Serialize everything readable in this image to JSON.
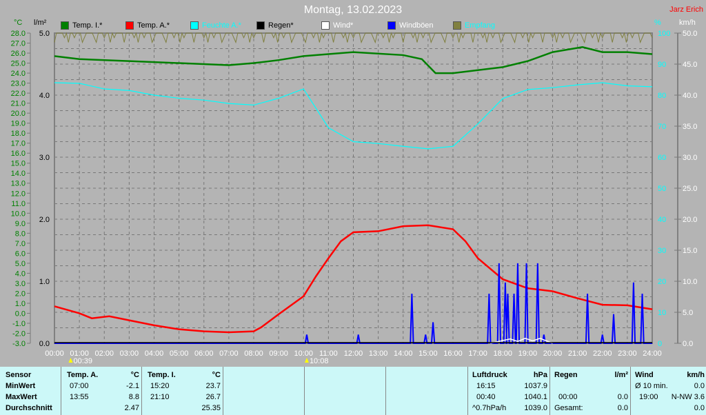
{
  "header": {
    "title": "Montag, 13.02.2023",
    "author": "Jarz Erich"
  },
  "axes": {
    "left1_unit": "°C",
    "left2_unit": "l/m²",
    "right1_unit": "%",
    "right2_unit": "km/h"
  },
  "legend": [
    {
      "label": "Temp. I.*",
      "color": "#008000",
      "text": "#000"
    },
    {
      "label": "Temp. A.*",
      "color": "#ff0000",
      "text": "#000"
    },
    {
      "label": "Feuchte A.*",
      "color": "#00ffff",
      "text": "#00ffff"
    },
    {
      "label": "Regen*",
      "color": "#000000",
      "text": "#000"
    },
    {
      "label": "Wind*",
      "color": "#ffffff",
      "text": "#fff"
    },
    {
      "label": "Windböen",
      "color": "#0000ff",
      "text": "#fff"
    },
    {
      "label": "Empfang",
      "color": "#808040",
      "text": "#00ffff"
    }
  ],
  "markers": [
    {
      "time": "00:39",
      "hour": 0.65
    },
    {
      "time": "10:08",
      "hour": 10.13
    }
  ],
  "chart_data": {
    "type": "line",
    "title": "Montag, 13.02.2023",
    "x_ticks": [
      "00:00",
      "01:00",
      "02:00",
      "03:00",
      "04:00",
      "05:00",
      "06:00",
      "07:00",
      "08:00",
      "09:00",
      "10:00",
      "11:00",
      "12:00",
      "13:00",
      "14:00",
      "15:00",
      "16:00",
      "17:00",
      "18:00",
      "19:00",
      "20:00",
      "21:00",
      "22:00",
      "23:00",
      "24:00"
    ],
    "y_temp_range": [
      -3,
      28
    ],
    "y_rain_range": [
      0,
      5
    ],
    "y_hum_range": [
      0,
      100
    ],
    "y_wind_range": [
      0,
      50
    ],
    "y_temp_ticks": [
      "28.0",
      "27.0",
      "26.0",
      "25.0",
      "24.0",
      "23.0",
      "22.0",
      "21.0",
      "20.0",
      "19.0",
      "18.0",
      "17.0",
      "16.0",
      "15.0",
      "14.0",
      "13.0",
      "12.0",
      "11.0",
      "10.0",
      "9.0",
      "8.0",
      "7.0",
      "6.0",
      "5.0",
      "4.0",
      "3.0",
      "2.0",
      "1.0",
      "0.0",
      "-1.0",
      "-2.0",
      "-3.0"
    ],
    "y_rain_ticks": [
      "5.0",
      "4.0",
      "3.0",
      "2.0",
      "1.0",
      "0.0"
    ],
    "y_hum_ticks": [
      "100",
      "90",
      "80",
      "70",
      "60",
      "50",
      "40",
      "30",
      "20",
      "10",
      "0"
    ],
    "y_wind_ticks": [
      "50.0",
      "45.0",
      "40.0",
      "35.0",
      "30.0",
      "25.0",
      "20.0",
      "15.0",
      "10.0",
      "5.0",
      "0.0"
    ],
    "series": [
      {
        "name": "Temp. I.",
        "unit": "°C",
        "color": "#008000",
        "points": [
          [
            0,
            25.7
          ],
          [
            1,
            25.4
          ],
          [
            3,
            25.2
          ],
          [
            5,
            25.0
          ],
          [
            7,
            24.8
          ],
          [
            8,
            25.0
          ],
          [
            9,
            25.3
          ],
          [
            10,
            25.7
          ],
          [
            12,
            26.1
          ],
          [
            14,
            25.8
          ],
          [
            14.75,
            25.4
          ],
          [
            15.3,
            24.0
          ],
          [
            16,
            24.0
          ],
          [
            17,
            24.3
          ],
          [
            18,
            24.6
          ],
          [
            19,
            25.2
          ],
          [
            20,
            26.1
          ],
          [
            21.2,
            26.6
          ],
          [
            22,
            26.1
          ],
          [
            23,
            26.1
          ],
          [
            24,
            25.9
          ]
        ]
      },
      {
        "name": "Temp. A.",
        "unit": "°C",
        "color": "#ff0000",
        "points": [
          [
            0,
            0.7
          ],
          [
            1,
            0.0
          ],
          [
            1.5,
            -0.5
          ],
          [
            2.2,
            -0.3
          ],
          [
            3,
            -0.7
          ],
          [
            4,
            -1.2
          ],
          [
            5,
            -1.6
          ],
          [
            6,
            -1.8
          ],
          [
            7,
            -1.9
          ],
          [
            8,
            -1.8
          ],
          [
            8.3,
            -1.4
          ],
          [
            9,
            -0.1
          ],
          [
            10,
            1.7
          ],
          [
            10.5,
            3.7
          ],
          [
            11,
            5.5
          ],
          [
            11.5,
            7.2
          ],
          [
            12,
            8.1
          ],
          [
            13,
            8.2
          ],
          [
            14,
            8.7
          ],
          [
            15,
            8.8
          ],
          [
            16,
            8.4
          ],
          [
            16.5,
            7.2
          ],
          [
            17,
            5.5
          ],
          [
            18,
            3.4
          ],
          [
            19,
            2.5
          ],
          [
            20,
            2.2
          ],
          [
            21,
            1.5
          ],
          [
            22,
            0.85
          ],
          [
            23,
            0.8
          ],
          [
            24,
            0.4
          ]
        ]
      },
      {
        "name": "Feuchte A.",
        "unit": "%",
        "color": "#00ffff",
        "points": [
          [
            0,
            84
          ],
          [
            1,
            83.8
          ],
          [
            2,
            82
          ],
          [
            3,
            81.5
          ],
          [
            4,
            80
          ],
          [
            5,
            79
          ],
          [
            6,
            78.4
          ],
          [
            7,
            77.3
          ],
          [
            8,
            76.8
          ],
          [
            9,
            79
          ],
          [
            10,
            82
          ],
          [
            11,
            69.5
          ],
          [
            12,
            65
          ],
          [
            13,
            64.4
          ],
          [
            14,
            63.5
          ],
          [
            15,
            62.7
          ],
          [
            16,
            63.5
          ],
          [
            17,
            70.7
          ],
          [
            18,
            78.9
          ],
          [
            19,
            81.8
          ],
          [
            20,
            82.4
          ],
          [
            21,
            83.3
          ],
          [
            22,
            84
          ],
          [
            23,
            83
          ],
          [
            24,
            82.7
          ]
        ]
      },
      {
        "name": "Windböen",
        "unit": "km/h",
        "color": "#0000ff",
        "spikes": [
          [
            10.13,
            1.4
          ],
          [
            12.2,
            1.4
          ],
          [
            14.35,
            8
          ],
          [
            14.9,
            1.4
          ],
          [
            15.2,
            3.4
          ],
          [
            17.45,
            8
          ],
          [
            17.85,
            12.9
          ],
          [
            18.1,
            9.8
          ],
          [
            18.2,
            8
          ],
          [
            18.45,
            8
          ],
          [
            18.6,
            12.9
          ],
          [
            18.95,
            12.9
          ],
          [
            19.4,
            12.9
          ],
          [
            19.65,
            1.4
          ],
          [
            21.4,
            8
          ],
          [
            22.0,
            1.4
          ],
          [
            22.45,
            4.7
          ],
          [
            23.25,
            9.8
          ],
          [
            23.6,
            8
          ]
        ]
      },
      {
        "name": "Wind",
        "unit": "km/h",
        "color": "#ffffff",
        "points": [
          [
            17.5,
            0
          ],
          [
            18.3,
            0.7
          ],
          [
            18.6,
            0.3
          ],
          [
            18.9,
            0.8
          ],
          [
            19.2,
            0.4
          ],
          [
            19.5,
            0.8
          ],
          [
            20,
            0
          ]
        ]
      }
    ]
  },
  "table": {
    "sensor": {
      "head": "Sensor",
      "rows": [
        "MinWert",
        "MaxWert",
        "Durchschnitt"
      ]
    },
    "temp_a": {
      "head": "Temp. A.",
      "unit": "°C",
      "min_time": "07:00",
      "min": "-2.1",
      "max_time": "13:55",
      "max": "8.8",
      "avg": "2.47"
    },
    "temp_i": {
      "head": "Temp. I.",
      "unit": "°C",
      "min_time": "15:20",
      "min": "23.7",
      "max_time": "21:10",
      "max": "26.7",
      "avg": "25.35"
    },
    "pressure": {
      "head": "Luftdruck",
      "unit": "hPa",
      "r1t": "16:15",
      "r1v": "1037.9",
      "r2t": "00:40",
      "r2v": "1040.1",
      "r3t": "^0.7hPa/h",
      "r3v": "1039.0"
    },
    "rain": {
      "head": "Regen",
      "unit": "l/m²",
      "r2t": "00:00",
      "r2v": "0.0",
      "r3t": "Gesamt:",
      "r3v": "0.0"
    },
    "wind": {
      "head": "Wind",
      "unit": "km/h",
      "r1t": "Ø 10 min.",
      "r1v": "0.0",
      "r2t": "19:00",
      "r2v": "N-NW 3.6",
      "r3v": "0.0"
    }
  }
}
